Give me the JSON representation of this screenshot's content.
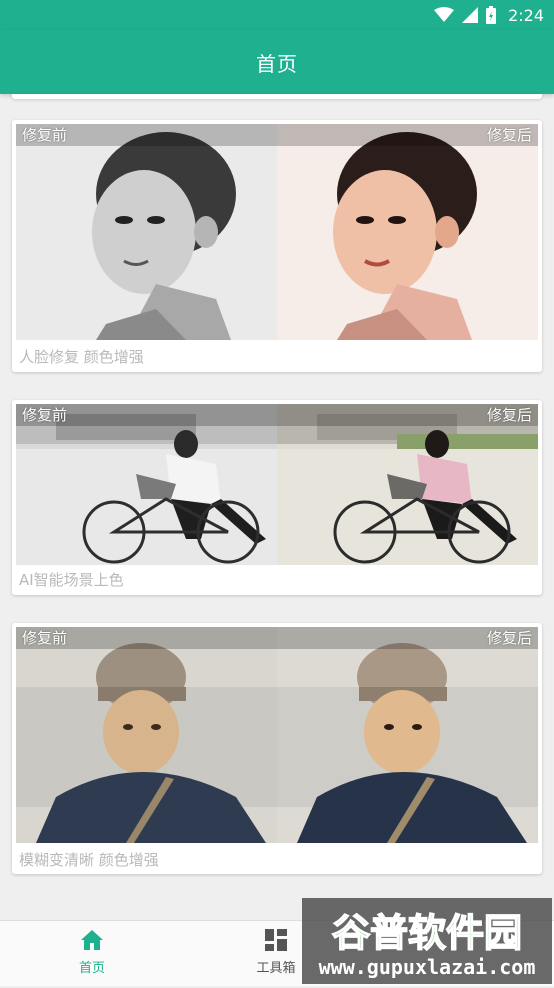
{
  "status_bar": {
    "time": "2:24"
  },
  "app_bar": {
    "title": "首页"
  },
  "cards": [
    {
      "before_label": "修复前",
      "after_label": "修复后",
      "caption": "人脸修复 颜色增强"
    },
    {
      "before_label": "修复前",
      "after_label": "修复后",
      "caption": "AI智能场景上色"
    },
    {
      "before_label": "修复前",
      "after_label": "修复后",
      "caption": "模糊变清晰 颜色增强"
    }
  ],
  "bottom_nav": {
    "items": [
      {
        "label": "首页",
        "icon": "home-icon",
        "active": true
      },
      {
        "label": "工具箱",
        "icon": "grid-icon",
        "active": false
      }
    ]
  },
  "watermark": {
    "title": "谷普软件园",
    "url": "www.gupuxlazai.com"
  },
  "colors": {
    "primary": "#1fb08f",
    "caption": "#b9b9b9"
  }
}
